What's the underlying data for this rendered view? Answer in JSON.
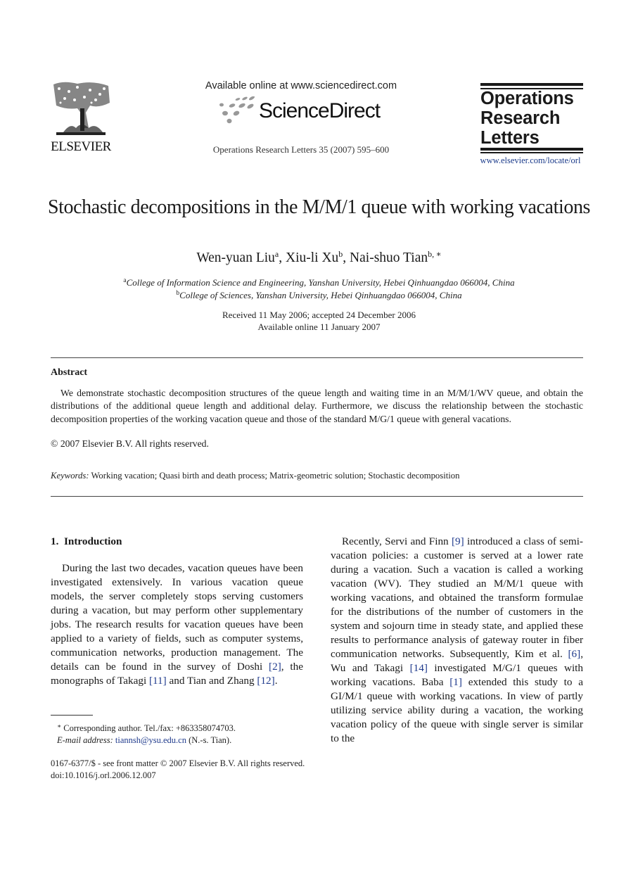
{
  "header": {
    "publisher_name": "ELSEVIER",
    "sd_available_text": "Available online at www.sciencedirect.com",
    "sd_brand": "ScienceDirect",
    "journal_citation": "Operations Research Letters 35 (2007) 595–600",
    "journal_logo_lines": [
      "Operations",
      "Research",
      "Letters"
    ],
    "journal_url": "www.elsevier.com/locate/orl"
  },
  "article": {
    "title": "Stochastic decompositions in the M/M/1 queue with working vacations",
    "authors": [
      {
        "name": "Wen-yuan Liu",
        "affil": "a",
        "sep": ", "
      },
      {
        "name": "Xiu-li Xu",
        "affil": "b",
        "sep": ", "
      },
      {
        "name": "Nai-shuo Tian",
        "affil": "b, ∗",
        "sep": ""
      }
    ],
    "affiliations": [
      {
        "mark": "a",
        "text": "College of Information Science and Engineering, Yanshan University, Hebei Qinhuangdao 066004, China"
      },
      {
        "mark": "b",
        "text": "College of Sciences, Yanshan University, Hebei Qinhuangdao 066004, China"
      }
    ],
    "received": "Received 11 May 2006; accepted 24 December 2006",
    "available_online": "Available online 11 January 2007"
  },
  "abstract": {
    "heading": "Abstract",
    "body": "We demonstrate stochastic decomposition structures of the queue length and waiting time in an M/M/1/WV queue, and obtain the distributions of the additional queue length and additional delay. Furthermore, we discuss the relationship between the stochastic decomposition properties of the working vacation queue and those of the standard M/G/1 queue with general vacations.",
    "copyright": "© 2007 Elsevier B.V. All rights reserved."
  },
  "keywords": {
    "label": "Keywords:",
    "text": "Working vacation; Quasi birth and death process; Matrix-geometric solution; Stochastic decomposition"
  },
  "introduction": {
    "heading": "1. Introduction",
    "left_paragraph": [
      {
        "t": "During the last two decades, vacation queues have been investigated extensively. In various vacation queue models, the server completely stops serving customers during a vacation, but may perform other supplementary jobs. The research results for vacation queues have been applied to a variety of fields, such as computer systems, communication networks, pro­duction management. The details can be found in the survey of Doshi "
      },
      {
        "c": "[2]"
      },
      {
        "t": ", the monographs of Takagi "
      },
      {
        "c": "[11]"
      },
      {
        "t": " and Tian and Zhang "
      },
      {
        "c": "[12]"
      },
      {
        "t": "."
      }
    ],
    "right_paragraph": [
      {
        "t": "Recently, Servi and Finn "
      },
      {
        "c": "[9]"
      },
      {
        "t": " introduced a class of semi-vacation policies: a customer is served at a lower rate during a vacation. Such a vacation is called a working vacation (WV). They studied an M/M/1 queue with working vacations, and obtained the trans­form formulae for the distributions of the number of customers in the system and sojourn time in steady state, and applied these results to performance anal­ysis of gateway router in fiber communication net­works. Subsequently, Kim et al. "
      },
      {
        "c": "[6]"
      },
      {
        "t": ", Wu and Takagi "
      },
      {
        "c": "[14]"
      },
      {
        "t": " investigated M/G/1 queues with working vaca­tions. Baba "
      },
      {
        "c": "[1]"
      },
      {
        "t": " extended this study to a GI/M/1 queue with working vacations. In view of partly utilizing service ability during a vacation, the working vacation policy of the queue with single server is similar to the"
      }
    ]
  },
  "footnote": {
    "mark": "∗",
    "corresponding": "Corresponding author. Tel./fax: +863358074703.",
    "email_label": "E-mail address:",
    "email": "tiannsh@ysu.edu.cn",
    "email_suffix": " (N.-s. Tian)."
  },
  "front_matter": {
    "issn_line": "0167-6377/$ - see front matter © 2007 Elsevier B.V. All rights reserved.",
    "doi": "doi:10.1016/j.orl.2006.12.007"
  },
  "colors": {
    "citation_link": "#1f3a8c",
    "text": "#1a1a1a"
  }
}
